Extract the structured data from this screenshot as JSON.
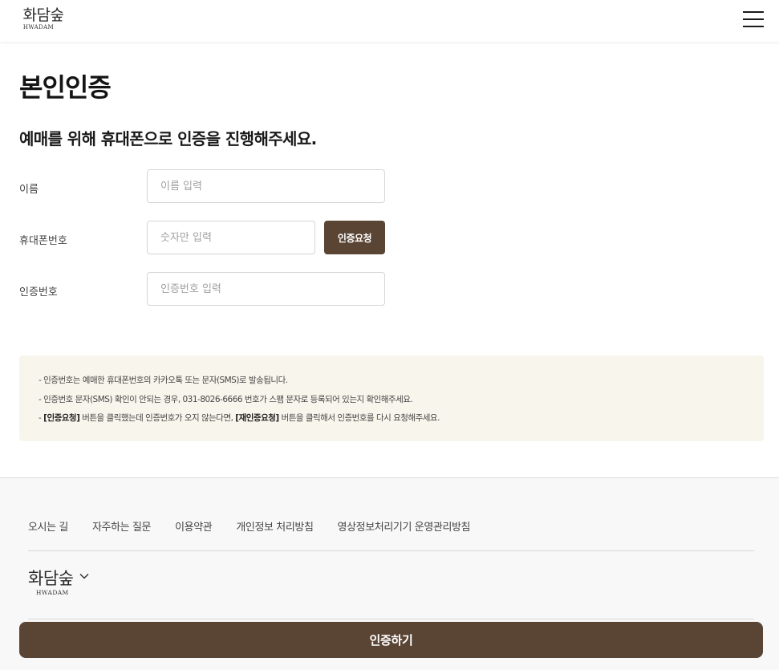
{
  "header": {
    "logo_kr": "화담숲",
    "logo_en": "HWADAM"
  },
  "page": {
    "title": "본인인증",
    "subtitle": "예매를 위해 휴대폰으로 인증을 진행해주세요."
  },
  "form": {
    "name_label": "이름",
    "name_placeholder": "이름 입력",
    "name_value": "",
    "phone_label": "휴대폰번호",
    "phone_placeholder": "숫자만 입력",
    "phone_value": "",
    "request_button": "인증요청",
    "code_label": "인증번호",
    "code_placeholder": "인증번호 입력",
    "code_value": ""
  },
  "notice": {
    "line1": "인증번호는 예매한 휴대폰번호의 카카오톡 또는 문자(SMS)로 발송됩니다.",
    "line2": "인증번호 문자(SMS) 확인이 안되는 경우, 031-8026-6666 번호가 스팸 문자로 등록되어 있는지 확인해주세요.",
    "line3_bold1": "[인증요청]",
    "line3_text1": " 버튼을 클릭했는데 인증번호가 오지 않는다면, ",
    "line3_bold2": "[재인증요청]",
    "line3_text2": " 버튼을 클릭해서 인증번호를 다시 요청해주세요."
  },
  "footer": {
    "links": [
      "오시는 길",
      "자주하는 질문",
      "이용약관",
      "개인정보 처리방침",
      "영상정보처리기기 운영관리방침"
    ],
    "logo_kr": "화담숲",
    "logo_en": "HWADAM"
  },
  "submit_button": "인증하기",
  "colors": {
    "brand_brown": "#5a4535",
    "notice_bg": "#f8f6ec",
    "footer_bg": "#f8f8f8"
  }
}
